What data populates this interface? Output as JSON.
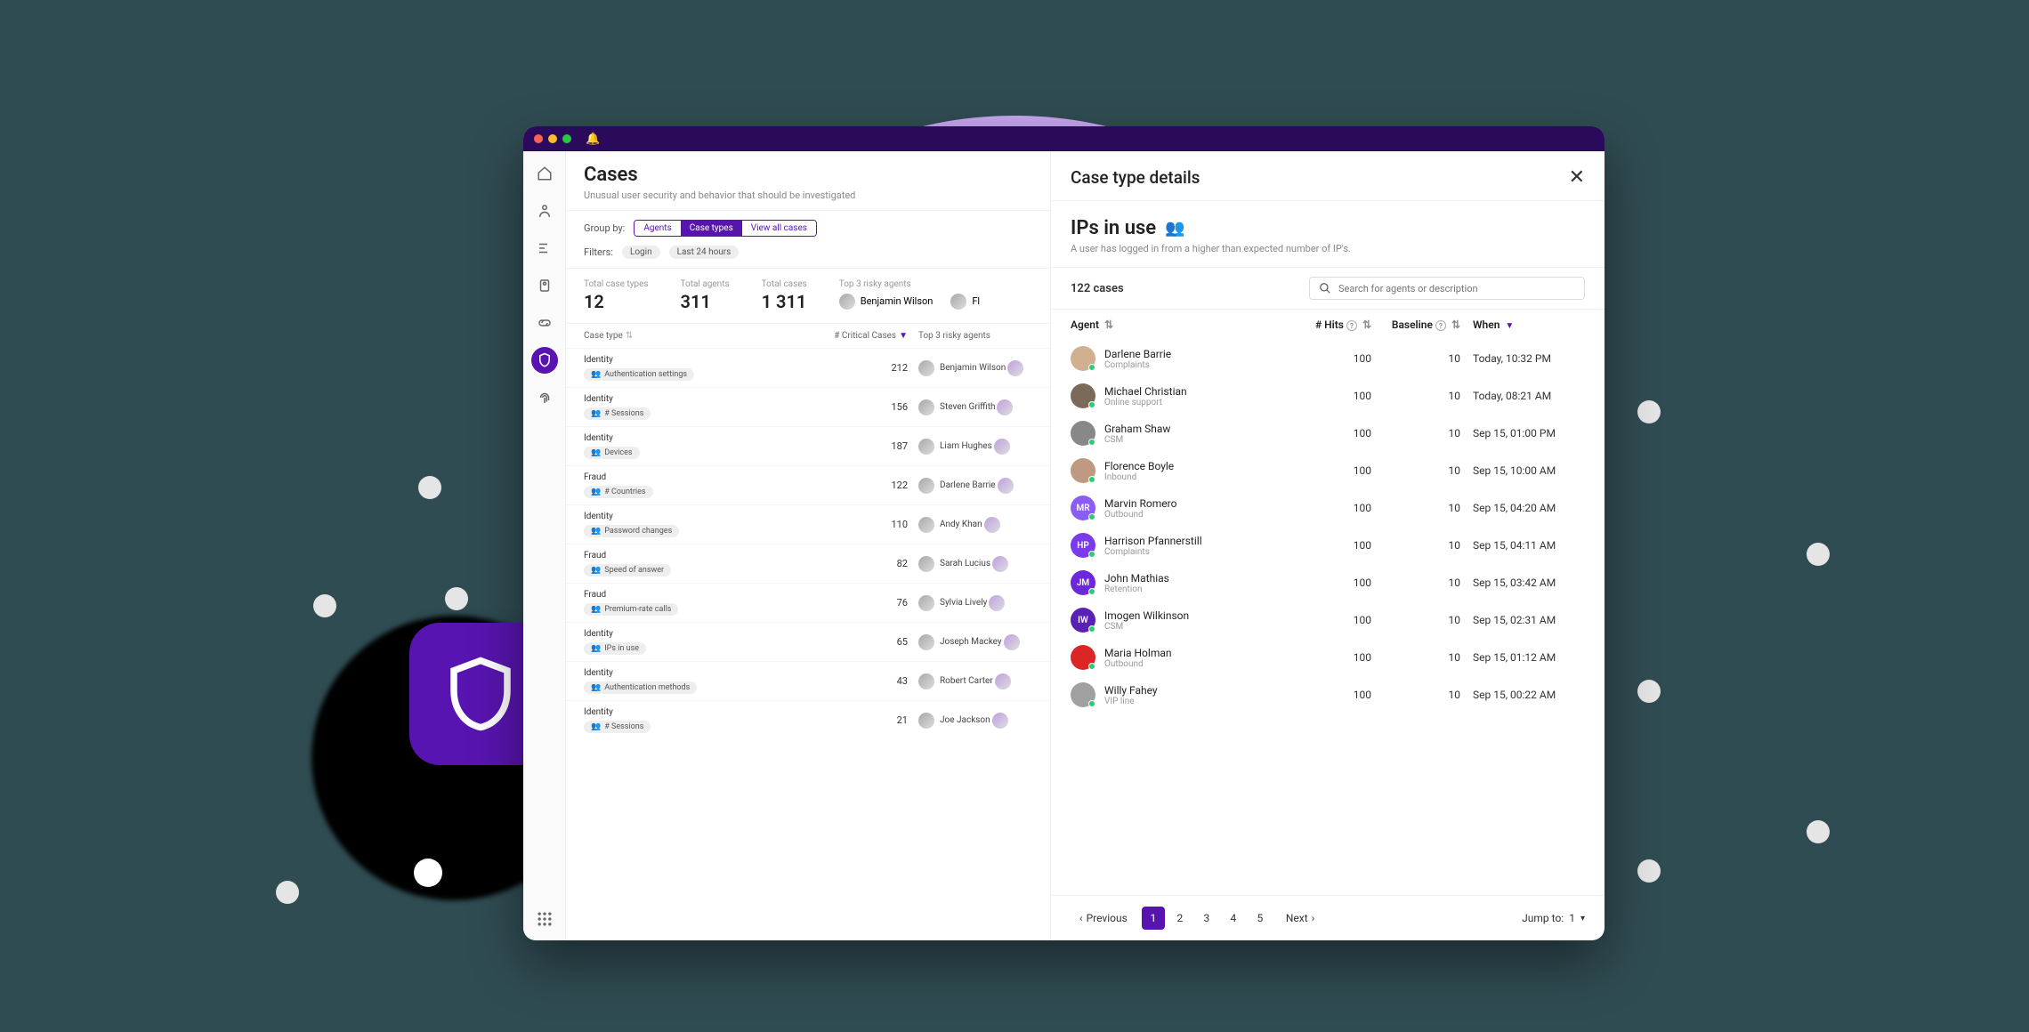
{
  "header": {
    "title": "Cases",
    "subtitle": "Unusual user security and behavior that should be investigated"
  },
  "group_by": {
    "label": "Group by:",
    "options": [
      "Agents",
      "Case types",
      "View all cases"
    ],
    "selected": "Case types"
  },
  "filters": {
    "label": "Filters:",
    "chips": [
      "Login",
      "Last 24 hours"
    ]
  },
  "metrics": {
    "total_case_types": {
      "label": "Total case types",
      "value": "12"
    },
    "total_agents": {
      "label": "Total agents",
      "value": "311"
    },
    "total_cases": {
      "label": "Total cases",
      "value": "1 311"
    },
    "top_risky": {
      "label": "Top 3 risky agents",
      "names": [
        "Benjamin Wilson",
        "Fl"
      ]
    }
  },
  "list_header": {
    "case_type": "Case type",
    "critical": "# Critical Cases",
    "risky": "Top 3 risky agents"
  },
  "case_types": [
    {
      "cat": "Identity",
      "tag": "Authentication settings",
      "count": 212,
      "agent": "Benjamin Wilson"
    },
    {
      "cat": "Identity",
      "tag": "# Sessions",
      "count": 156,
      "agent": "Steven Griffith"
    },
    {
      "cat": "Identity",
      "tag": "Devices",
      "count": 187,
      "agent": "Liam Hughes"
    },
    {
      "cat": "Fraud",
      "tag": "# Countries",
      "count": 122,
      "agent": "Darlene Barrie"
    },
    {
      "cat": "Identity",
      "tag": "Password changes",
      "count": 110,
      "agent": "Andy Khan"
    },
    {
      "cat": "Fraud",
      "tag": "Speed of answer",
      "count": 82,
      "agent": "Sarah Lucius"
    },
    {
      "cat": "Fraud",
      "tag": "Premium-rate calls",
      "count": 76,
      "agent": "Sylvia Lively"
    },
    {
      "cat": "Identity",
      "tag": "IPs in use",
      "count": 65,
      "agent": "Joseph Mackey"
    },
    {
      "cat": "Identity",
      "tag": "Authentication methods",
      "count": 43,
      "agent": "Robert Carter"
    },
    {
      "cat": "Identity",
      "tag": "# Sessions",
      "count": 21,
      "agent": "Joe Jackson"
    }
  ],
  "detail": {
    "pane_title": "Case type details",
    "name": "IPs in use",
    "desc": "A user has logged in from a higher than expected number of IP's.",
    "count_label": "122 cases",
    "search_placeholder": "Search for agents or description",
    "columns": {
      "agent": "Agent",
      "hits": "# Hits",
      "baseline": "Baseline",
      "when": "When"
    },
    "rows": [
      {
        "name": "Darlene Barrie",
        "dept": "Complaints",
        "hits": 100,
        "baseline": 10,
        "when": "Today, 10:32 PM",
        "av": "img",
        "color": "#d0b090"
      },
      {
        "name": "Michael Christian",
        "dept": "Online support",
        "hits": 100,
        "baseline": 10,
        "when": "Today, 08:21 AM",
        "av": "img",
        "color": "#7a6a5a"
      },
      {
        "name": "Graham Shaw",
        "dept": "CSM",
        "hits": 100,
        "baseline": 10,
        "when": "Sep 15, 01:00 PM",
        "av": "img",
        "color": "#888"
      },
      {
        "name": "Florence Boyle",
        "dept": "Inbound",
        "hits": 100,
        "baseline": 10,
        "when": "Sep 15, 10:00 AM",
        "av": "img",
        "color": "#c09a80"
      },
      {
        "name": "Marvin Romero",
        "dept": "Outbound",
        "hits": 100,
        "baseline": 10,
        "when": "Sep 15, 04:20 AM",
        "av": "MR",
        "color": "#8b5cf6"
      },
      {
        "name": "Harrison Pfannerstill",
        "dept": "Complaints",
        "hits": 100,
        "baseline": 10,
        "when": "Sep 15, 04:11 AM",
        "av": "HP",
        "color": "#7c3aed"
      },
      {
        "name": "John Mathias",
        "dept": "Retention",
        "hits": 100,
        "baseline": 10,
        "when": "Sep 15, 03:42 AM",
        "av": "JM",
        "color": "#6d28d9"
      },
      {
        "name": "Imogen Wilkinson",
        "dept": "CSM",
        "hits": 100,
        "baseline": 10,
        "when": "Sep 15, 02:31 AM",
        "av": "IW",
        "color": "#5b21b6"
      },
      {
        "name": "Maria Holman",
        "dept": "Outbound",
        "hits": 100,
        "baseline": 10,
        "when": "Sep 15, 01:12 AM",
        "av": "img",
        "color": "#dc2626"
      },
      {
        "name": "Willy Fahey",
        "dept": "VIP line",
        "hits": 100,
        "baseline": 10,
        "when": "Sep 15, 00:22 AM",
        "av": "img",
        "color": "#a0a0a0"
      }
    ],
    "pagination": {
      "prev": "Previous",
      "next": "Next",
      "pages": [
        "1",
        "2",
        "3",
        "4",
        "5"
      ],
      "current": "1",
      "jump_label": "Jump to:",
      "jump_value": "1"
    }
  }
}
